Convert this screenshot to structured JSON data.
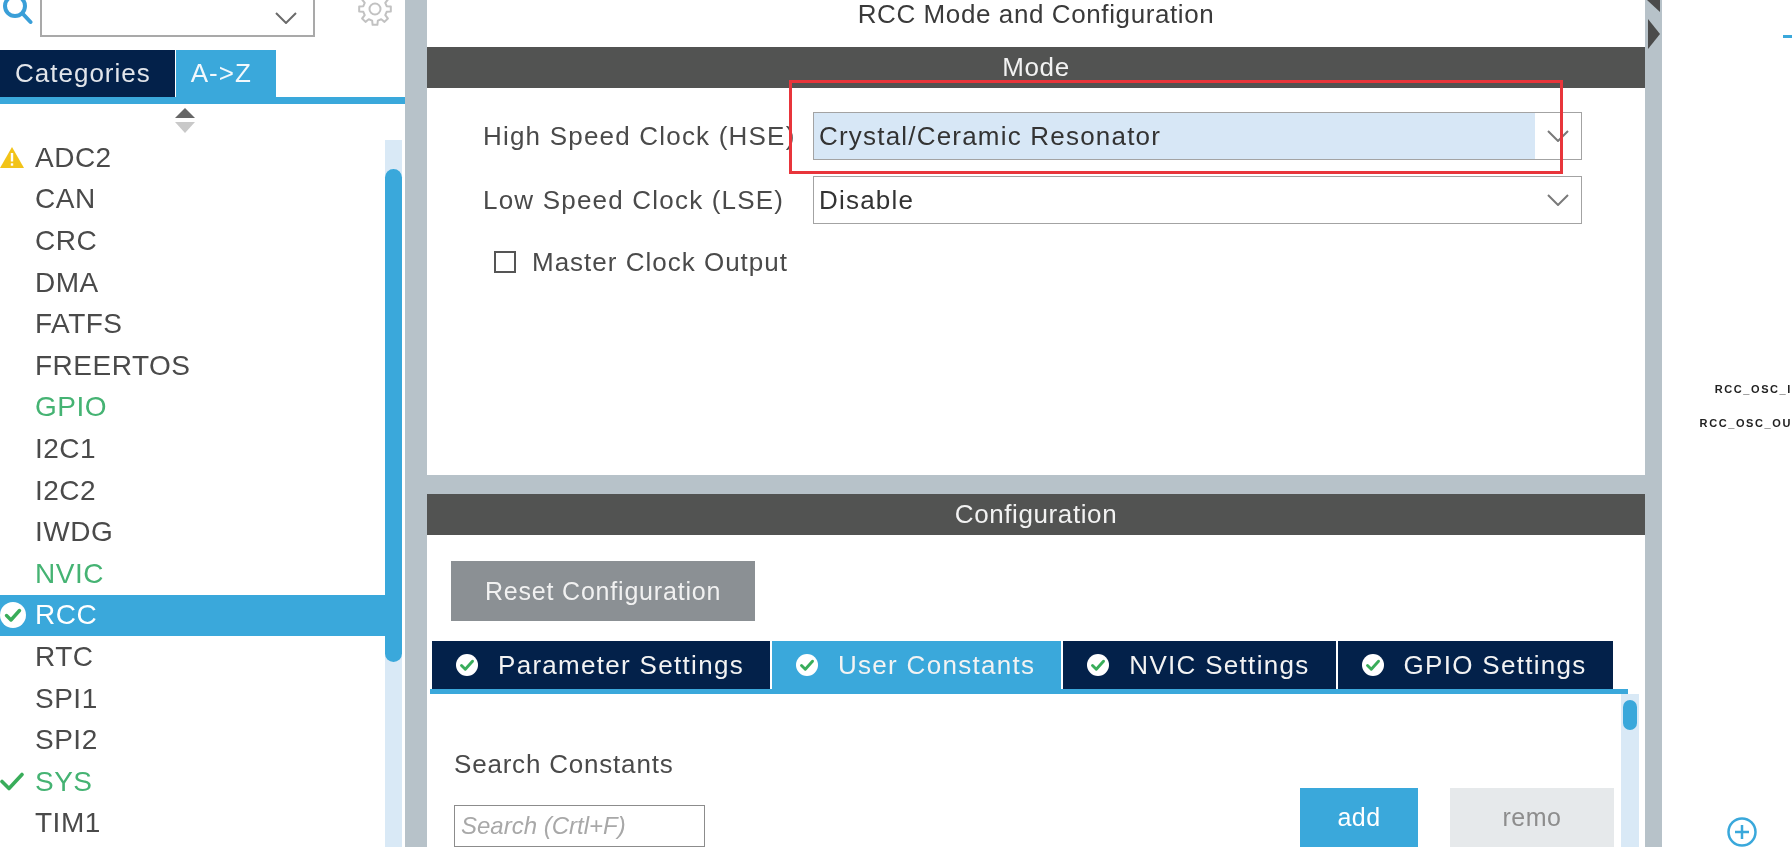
{
  "sidebar": {
    "tabs": [
      {
        "label": "Categories",
        "selected": false
      },
      {
        "label": "A->Z",
        "selected": true
      }
    ],
    "items": [
      {
        "label": "ADC2",
        "kind": "warning",
        "configured": false,
        "selected": false
      },
      {
        "label": "CAN",
        "kind": "plain",
        "configured": false,
        "selected": false
      },
      {
        "label": "CRC",
        "kind": "plain",
        "configured": false,
        "selected": false
      },
      {
        "label": "DMA",
        "kind": "plain",
        "configured": false,
        "selected": false
      },
      {
        "label": "FATFS",
        "kind": "plain",
        "configured": false,
        "selected": false
      },
      {
        "label": "FREERTOS",
        "kind": "plain",
        "configured": false,
        "selected": false
      },
      {
        "label": "GPIO",
        "kind": "plain",
        "configured": true,
        "selected": false
      },
      {
        "label": "I2C1",
        "kind": "plain",
        "configured": false,
        "selected": false
      },
      {
        "label": "I2C2",
        "kind": "plain",
        "configured": false,
        "selected": false
      },
      {
        "label": "IWDG",
        "kind": "plain",
        "configured": false,
        "selected": false
      },
      {
        "label": "NVIC",
        "kind": "plain",
        "configured": true,
        "selected": false
      },
      {
        "label": "RCC",
        "kind": "ok",
        "configured": true,
        "selected": true
      },
      {
        "label": "RTC",
        "kind": "plain",
        "configured": false,
        "selected": false
      },
      {
        "label": "SPI1",
        "kind": "plain",
        "configured": false,
        "selected": false
      },
      {
        "label": "SPI2",
        "kind": "plain",
        "configured": false,
        "selected": false
      },
      {
        "label": "SYS",
        "kind": "ok",
        "configured": true,
        "selected": false
      },
      {
        "label": "TIM1",
        "kind": "plain",
        "configured": false,
        "selected": false
      }
    ]
  },
  "panel": {
    "title": "RCC Mode and Configuration",
    "mode": {
      "heading": "Mode",
      "fields": [
        {
          "label": "High Speed Clock (HSE)",
          "value": "Crystal/Ceramic Resonator",
          "focused": true,
          "highlighted": true
        },
        {
          "label": "Low Speed Clock (LSE)",
          "value": "Disable",
          "focused": false,
          "highlighted": false
        }
      ],
      "checkbox": {
        "label": "Master Clock Output",
        "checked": false
      }
    },
    "configuration": {
      "heading": "Configuration",
      "reset_button": "Reset Configuration",
      "tabs": [
        {
          "label": "Parameter Settings",
          "ok": true,
          "selected": false
        },
        {
          "label": "User Constants",
          "ok": true,
          "selected": true
        },
        {
          "label": "NVIC Settings",
          "ok": true,
          "selected": false
        },
        {
          "label": "GPIO Settings",
          "ok": true,
          "selected": false
        }
      ],
      "search_label": "Search Constants",
      "search": {
        "placeholder": "Search (Crtl+F)"
      },
      "buttons": [
        {
          "label": "add",
          "kind": "primary"
        },
        {
          "label": "remo",
          "kind": "secondary"
        }
      ]
    }
  },
  "pinout": {
    "pins": [
      {
        "label": "RCC_OSC_I"
      },
      {
        "label": "RCC_OSC_OU"
      }
    ]
  }
}
